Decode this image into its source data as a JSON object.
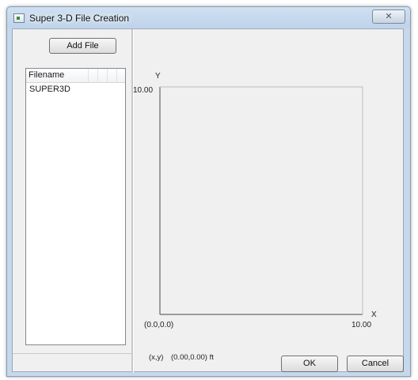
{
  "window": {
    "title": "Super 3-D File Creation",
    "close_glyph": "✕"
  },
  "toolbar": {
    "add_file_label": "Add File"
  },
  "file_list": {
    "column_header": "Filename",
    "rows": [
      "SUPER3D"
    ]
  },
  "plot": {
    "y_axis_label": "Y",
    "x_axis_label": "X",
    "y_max_label": "10.00",
    "x_max_label": "10.00",
    "origin_label": "(0.0,0.0)"
  },
  "status": {
    "coord_label": "(x,y)",
    "coord_value": "(0.00,0.00) ft"
  },
  "buttons": {
    "ok_label": "OK",
    "cancel_label": "Cancel"
  },
  "icons": {
    "app": "app-window-icon",
    "close": "close-icon"
  }
}
